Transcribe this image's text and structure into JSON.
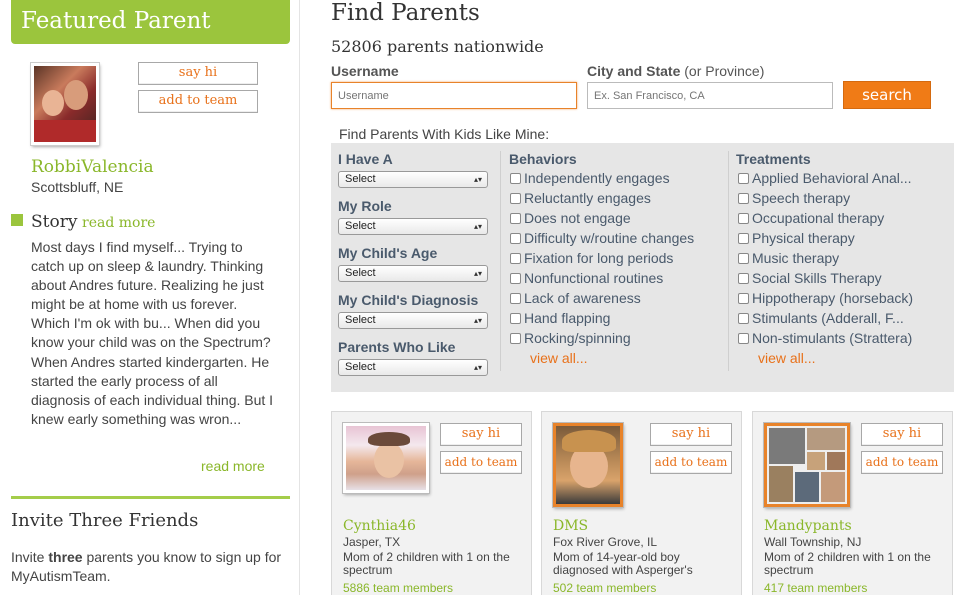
{
  "featured": {
    "header": "Featured Parent",
    "say_hi": "say hi",
    "add_to_team": "add to team",
    "name": "RobbiValencia",
    "location": "Scottsbluff, NE",
    "story_title": "Story",
    "story_read_more": "read more",
    "story_text": "Most days I find myself... Trying to catch up on sleep & laundry. Thinking about Andres future. Realizing he just might be at home with us forever. Which I'm ok with bu... When did you know your child was on the Spectrum? When Andres started kindergarten. He started the early process of all diagnosis of each individual thing. But I knew early something was wron...",
    "read_more_bottom": "read more"
  },
  "invite": {
    "title": "Invite Three Friends",
    "text_pre": "Invite ",
    "text_bold": "three",
    "text_post": " parents you know to sign up for MyAutismTeam."
  },
  "main": {
    "title": "Find Parents",
    "count_text": "52806 parents nationwide"
  },
  "search": {
    "username_label": "Username",
    "username_placeholder": "Username",
    "city_label_bold": "City and State",
    "city_label_rest": " (or Province)",
    "city_placeholder": "Ex. San Francisco, CA",
    "button": "search"
  },
  "filters": {
    "title": "Find Parents With Kids Like Mine:",
    "selects": [
      {
        "label": "I Have A",
        "value": "Select"
      },
      {
        "label": "My Role",
        "value": "Select"
      },
      {
        "label": "My Child's Age",
        "value": "Select"
      },
      {
        "label": "My Child's Diagnosis",
        "value": "Select"
      },
      {
        "label": "Parents Who Like",
        "value": "Select"
      }
    ],
    "behaviors": {
      "heading": "Behaviors",
      "items": [
        "Independently engages",
        "Reluctantly engages",
        "Does not engage",
        "Difficulty w/routine changes",
        "Fixation for long periods",
        "Nonfunctional routines",
        "Lack of awareness",
        "Hand flapping",
        "Rocking/spinning"
      ],
      "view_all": "view all..."
    },
    "treatments": {
      "heading": "Treatments",
      "items": [
        "Applied Behavioral Anal...",
        "Speech therapy",
        "Occupational therapy",
        "Physical therapy",
        "Music therapy",
        "Social Skills Therapy",
        "Hippotherapy (horseback)",
        "Stimulants (Adderall, F...",
        "Non-stimulants (Strattera)"
      ],
      "view_all": "view all..."
    }
  },
  "cards": [
    {
      "name": "Cynthia46",
      "location": "Jasper, TX",
      "description": "Mom of 2 children with 1 on the spectrum",
      "members": "5886 team members",
      "say_hi": "say hi",
      "add_to_team": "add to team"
    },
    {
      "name": "DMS",
      "location": "Fox River Grove, IL",
      "description": "Mom of 14-year-old boy diagnosed with Asperger's",
      "members": "502 team members",
      "say_hi": "say hi",
      "add_to_team": "add to team"
    },
    {
      "name": "Mandypants",
      "location": "Wall Township, NJ",
      "description": "Mom of 2 children with 1 on the spectrum",
      "members": "417 team members",
      "say_hi": "say hi",
      "add_to_team": "add to team"
    }
  ],
  "colors": {
    "brand_green": "#9bc53d",
    "link_green": "#8ab72a",
    "accent_orange": "#f07b16",
    "filter_bg": "#e6e6e6",
    "filter_text": "#4a5a6c"
  }
}
